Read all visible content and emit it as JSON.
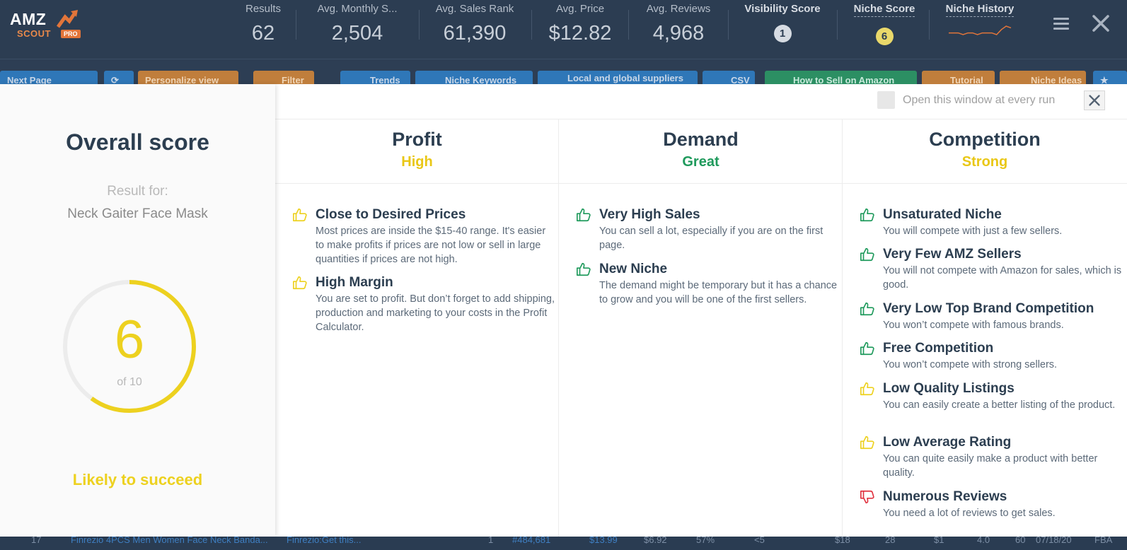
{
  "logo": {
    "line1": "AMZ",
    "line2": "SCOUT",
    "badge": "PRO"
  },
  "stats": [
    {
      "label": "Results",
      "value": "62"
    },
    {
      "label": "Avg. Monthly S...",
      "value": "2,504"
    },
    {
      "label": "Avg. Sales Rank",
      "value": "61,390"
    },
    {
      "label": "Avg. Price",
      "value": "$12.82"
    },
    {
      "label": "Avg. Reviews",
      "value": "4,968"
    }
  ],
  "visibility": {
    "label": "Visibility Score",
    "value": "1",
    "color": "#d6dbe2"
  },
  "niche_score": {
    "label": "Niche Score",
    "value": "6",
    "color": "#e9d86a"
  },
  "niche_history": {
    "label": "Niche History",
    "trend": [
      6,
      6,
      6,
      5,
      6,
      6,
      5,
      6,
      6,
      6,
      5,
      8,
      10,
      9
    ]
  },
  "toolbar": {
    "next_page": "Next Page",
    "personalize": "Personalize view",
    "filter": "Filter",
    "trends": "Trends",
    "niche_keywords": "Niche Keywords",
    "suppliers": "Local and global suppliers",
    "csv": "CSV",
    "how_to_sell": "How to Sell on Amazon",
    "tutorial": "Tutorial",
    "niche_ideas": "Niche Ideas"
  },
  "bottom_row": {
    "num": "17",
    "product": "Finrezio 4PCS Men Women Face Neck Banda...",
    "brand": "Finrezio:Get this...",
    "c1": "1",
    "rank": "#484,681",
    "price": "$13.99",
    "fee": "$6.92",
    "pct": "57%",
    "rev_s": "<5",
    "rev": "$18",
    "cnt": "28",
    "sellers": "$1",
    "rating": "4.0",
    "days": "60",
    "date": "07/18/20",
    "type": "FBA"
  },
  "modal": {
    "overall_title": "Overall score",
    "result_for": "Result for:",
    "query": "Neck Gaiter Face Mask",
    "score": "6",
    "score_of": "of 10",
    "score_fraction": 0.6,
    "verdict": "Likely to succeed",
    "window_option": "Open this window at every run",
    "colors": {
      "yellow": "#edd11f",
      "green": "#1f9a5c",
      "red": "#e0323f"
    },
    "columns": [
      {
        "title": "Profit",
        "rating": "High",
        "rating_color": "#e9c716",
        "items": [
          {
            "title": "Close to Desired Prices",
            "desc": "Most prices are inside the $15-40 range. It's easier to make profits if prices are not low or sell in large quantities if prices are not high.",
            "icon": "thumbs-up-icon",
            "tone": "yellow"
          },
          {
            "title": "High Margin",
            "desc": "You are set to profit. But don’t forget to add shipping, production and marketing to your costs in the Profit Calculator.",
            "icon": "thumbs-up-icon",
            "tone": "yellow"
          }
        ]
      },
      {
        "title": "Demand",
        "rating": "Great",
        "rating_color": "#1f9a5c",
        "items": [
          {
            "title": "Very High Sales",
            "desc": "You can sell a lot, especially if you are on the first page.",
            "icon": "thumbs-up-icon",
            "tone": "green"
          },
          {
            "title": "New Niche",
            "desc": "The demand might be temporary but it has a chance to grow and you will be one of the first sellers.",
            "icon": "thumbs-up-icon",
            "tone": "green"
          }
        ]
      },
      {
        "title": "Competition",
        "rating": "Strong",
        "rating_color": "#e9c716",
        "items": [
          {
            "title": "Unsaturated Niche",
            "desc": "You will compete with just a few sellers.",
            "icon": "thumbs-up-icon",
            "tone": "green"
          },
          {
            "title": "Very Few AMZ Sellers",
            "desc": "You will not compete with Amazon for sales, which is good.",
            "icon": "thumbs-up-icon",
            "tone": "green"
          },
          {
            "title": "Very Low Top Brand Competition",
            "desc": "You won’t compete with famous brands.",
            "icon": "thumbs-up-icon",
            "tone": "green"
          },
          {
            "title": "Free Competition",
            "desc": "You won’t compete with strong sellers.",
            "icon": "thumbs-up-icon",
            "tone": "green"
          },
          {
            "title": "Low Quality Listings",
            "desc": "You can easily create a better listing of the product.",
            "icon": "thumbs-up-icon",
            "tone": "yellow"
          },
          {
            "title": "Low Average Rating",
            "desc": "You can quite easily make a product with better quality.",
            "icon": "thumbs-up-icon",
            "tone": "yellow"
          },
          {
            "title": "Numerous Reviews",
            "desc": "You need a lot of reviews to get sales.",
            "icon": "thumbs-down-icon",
            "tone": "red"
          }
        ]
      }
    ]
  }
}
